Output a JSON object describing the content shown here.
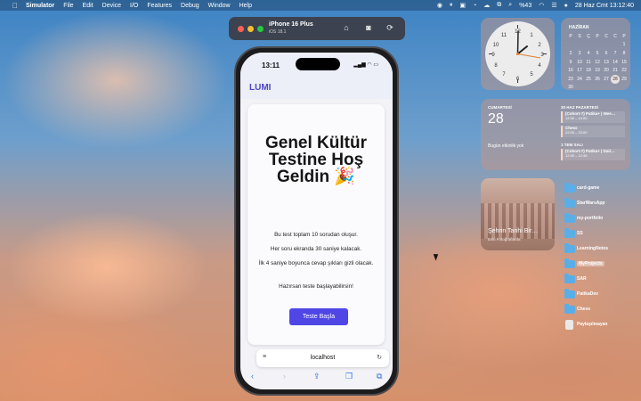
{
  "menubar": {
    "app": "Simulator",
    "items": [
      "File",
      "Edit",
      "Device",
      "I/O",
      "Features",
      "Debug",
      "Window",
      "Help"
    ],
    "battery": "%43",
    "datetime": "28 Haz Cmt  13:12:40"
  },
  "simulator": {
    "device": "iPhone 16 Plus",
    "os": "iOS 18.1"
  },
  "phone": {
    "time": "13:11",
    "brand": "LUMI",
    "heading": "Genel Kültür Testine Hoş Geldin 🎉",
    "paragraphs": [
      "Bu test toplam 10 sorudan oluşur.",
      "Her soru ekranda 30 saniye kalacak.",
      "İlk 4 saniye boyunca cevap şıkları gizli olacak.",
      "Hazırsan teste başlayabilirsin!"
    ],
    "start_button": "Teste Başla",
    "url": "localhost"
  },
  "calendar": {
    "month": "HAZİRAN",
    "weekdays": [
      "P",
      "S",
      "Ç",
      "P",
      "C",
      "C",
      "P"
    ],
    "rows": [
      [
        "",
        "",
        "",
        "",
        "",
        "",
        "1"
      ],
      [
        "2",
        "3",
        "4",
        "5",
        "6",
        "7",
        "8"
      ],
      [
        "9",
        "10",
        "11",
        "12",
        "13",
        "14",
        "15"
      ],
      [
        "16",
        "17",
        "18",
        "19",
        "20",
        "21",
        "22"
      ],
      [
        "23",
        "24",
        "25",
        "26",
        "27",
        "28",
        "29"
      ],
      [
        "30",
        "",
        "",
        "",
        "",
        "",
        ""
      ]
    ],
    "today": "28"
  },
  "agenda": {
    "day_name": "CUMARTESİ",
    "day_num": "28",
    "no_events": "Bugün etkinlik yok",
    "next_header": "30 HAZ PAZARTESİ",
    "events": [
      {
        "title": "(Cohort-7) Patika+ | Wee…",
        "time": "12:30 – 13:00"
      },
      {
        "title": "Chess",
        "time": "22:00 – 23:00"
      }
    ],
    "next_header2": "1 TEM SALI",
    "events2": [
      {
        "title": "(Cohort-7) Patika+ | Dail…",
        "time": "12:30 – 12:45"
      }
    ]
  },
  "photo": {
    "title": "Şehrin Tarihi Bir…",
    "subtitle": "Eski Fotoğraflarda"
  },
  "folders": [
    "card-game",
    "StarWarsApp",
    "my-portfolio",
    "SS",
    "LearningNotes",
    "MyProjects",
    "SAR",
    "PatikaDev",
    "Chess",
    "Paylaşılmayan"
  ]
}
